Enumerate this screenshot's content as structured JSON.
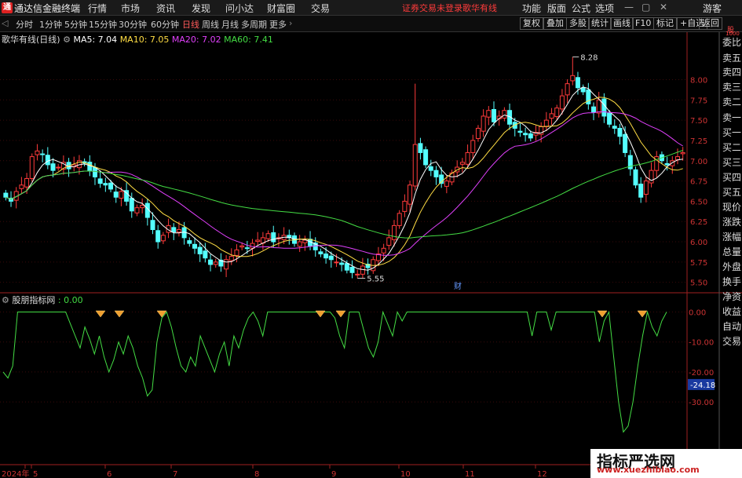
{
  "app": {
    "logo_char": "通",
    "name": "通达信金融终端",
    "menus": [
      "行情",
      "市场",
      "资讯",
      "发现",
      "问小达",
      "财富圈",
      "交易"
    ],
    "warn": "证券交易未登录",
    "indicator_title": "歌华有线",
    "right_menus": [
      "功能",
      "版面",
      "公式",
      "选项"
    ],
    "guest": "游客"
  },
  "toolbar": {
    "periods": [
      "分时",
      "1分钟",
      "5分钟",
      "15分钟",
      "30分钟",
      "60分钟",
      "日线",
      "周线",
      "月线",
      "多周期",
      "更多"
    ],
    "active": "日线",
    "right": [
      "复权",
      "叠加",
      "多股",
      "统计",
      "画线",
      "F10",
      "标记",
      "+自选",
      "返回"
    ]
  },
  "main_legend": {
    "title": "歌华有线(日线)",
    "ma": [
      {
        "label": "MA5: 7.04",
        "color": "#ffffff"
      },
      {
        "label": "MA10: 7.05",
        "color": "#ffdd44"
      },
      {
        "label": "MA20: 7.02",
        "color": "#e040fb"
      },
      {
        "label": "MA60: 7.41",
        "color": "#44dd44"
      }
    ]
  },
  "sub_legend": {
    "title": "股朋指标网",
    "value": ": 0.00",
    "value_color": "#44dd44"
  },
  "side_panel": [
    "委比",
    "卖五",
    "卖四",
    "卖三",
    "卖二",
    "卖一",
    "买一",
    "买二",
    "买三",
    "买四",
    "买五",
    "现价",
    "涨跌",
    "涨幅",
    "总量",
    "外盘",
    "换手",
    "净资",
    "收益",
    "自动",
    "交易"
  ],
  "side_top_labels": [
    "股",
    "1000"
  ],
  "watermark": {
    "title": "指标严选网",
    "url": "www.xuezhibiao.com"
  },
  "chart_data": [
    {
      "type": "candlestick",
      "title": "歌华有线(日线)",
      "ylim": [
        5.4,
        8.45
      ],
      "y_ticks": [
        5.5,
        5.75,
        6.0,
        6.25,
        6.5,
        6.75,
        7.0,
        7.25,
        7.5,
        7.75,
        8.0
      ],
      "x_labels": [
        "2024年",
        "5",
        "6",
        "7",
        "8",
        "9",
        "10",
        "11",
        "12"
      ],
      "annotations": [
        {
          "label": "8.28",
          "value": 8.28
        },
        {
          "label": "5.55",
          "value": 5.55
        }
      ],
      "event_markers": [
        "财"
      ],
      "close": [
        6.55,
        6.5,
        6.62,
        6.7,
        6.78,
        7.05,
        7.12,
        7.08,
        6.95,
        6.88,
        6.92,
        6.98,
        6.9,
        6.95,
        7.0,
        6.97,
        6.88,
        6.8,
        6.72,
        6.7,
        6.65,
        6.55,
        6.62,
        6.5,
        6.38,
        6.42,
        6.45,
        6.3,
        6.15,
        6.0,
        6.08,
        6.2,
        6.12,
        6.15,
        6.05,
        5.98,
        5.92,
        5.85,
        5.8,
        5.72,
        5.75,
        5.7,
        5.78,
        5.82,
        5.9,
        5.95,
        5.92,
        5.98,
        6.02,
        6.05,
        6.1,
        6.0,
        6.05,
        6.08,
        6.05,
        5.98,
        6.0,
        6.02,
        5.95,
        5.9,
        5.85,
        5.8,
        5.78,
        5.75,
        5.72,
        5.65,
        5.62,
        5.6,
        5.7,
        5.68,
        5.78,
        5.85,
        5.92,
        6.05,
        6.2,
        6.35,
        6.5,
        6.7,
        7.2,
        7.1,
        6.95,
        6.88,
        6.8,
        6.72,
        6.75,
        6.85,
        6.92,
        6.98,
        7.1,
        7.25,
        7.4,
        7.55,
        7.62,
        7.48,
        7.55,
        7.62,
        7.45,
        7.4,
        7.35,
        7.32,
        7.28,
        7.35,
        7.42,
        7.5,
        7.58,
        7.65,
        7.8,
        7.95,
        8.05,
        7.9,
        7.85,
        7.7,
        7.6,
        7.75,
        7.55,
        7.45,
        7.4,
        7.3,
        7.1,
        6.9,
        6.7,
        6.55,
        6.75,
        6.88,
        7.05,
        7.0,
        6.95,
        7.0,
        7.05,
        7.1
      ],
      "series": [
        {
          "name": "MA5",
          "color": "#ffffff",
          "last": 7.04
        },
        {
          "name": "MA10",
          "color": "#ffdd44",
          "last": 7.05
        },
        {
          "name": "MA20",
          "color": "#e040fb",
          "last": 7.02
        },
        {
          "name": "MA60",
          "color": "#44dd44",
          "last": 7.41
        }
      ]
    },
    {
      "type": "line",
      "title": "股朋指标网",
      "ylim": [
        -42,
        3
      ],
      "y_ticks": [
        0.0,
        -10.0,
        -20.0,
        -30.0
      ],
      "last_value": -24.18,
      "values": [
        -20,
        -22,
        -18,
        0,
        0,
        0,
        0,
        0,
        0,
        0,
        0,
        0,
        0,
        0,
        -4,
        -8,
        -12,
        -5,
        -9,
        -14,
        -8,
        -15,
        -20,
        -16,
        -10,
        -14,
        -8,
        -12,
        -18,
        -22,
        -28,
        -26,
        -10,
        -2,
        0,
        -5,
        -12,
        -18,
        -20,
        -15,
        -18,
        -8,
        -12,
        -16,
        -20,
        -14,
        -10,
        -18,
        -8,
        -12,
        -6,
        -2,
        0,
        -3,
        -8,
        0,
        0,
        0,
        0,
        0,
        0,
        0,
        0,
        0,
        0,
        0,
        0,
        0,
        0,
        -2,
        -8,
        -12,
        0,
        0,
        0,
        -6,
        -12,
        -15,
        -10,
        0,
        -4,
        -8,
        0,
        -3,
        0,
        0,
        0,
        0,
        0,
        0,
        0,
        0,
        0,
        0,
        0,
        0,
        0,
        0,
        0,
        0,
        0,
        0,
        0,
        0,
        0,
        0,
        0,
        0,
        0,
        0,
        -8,
        0,
        0,
        0,
        -6,
        0,
        0,
        0,
        0,
        0,
        0,
        0,
        0,
        0,
        -10,
        -3,
        0,
        -15,
        -30,
        -40,
        -38,
        -30,
        -18,
        -8,
        0,
        -5,
        -8,
        -3,
        0
      ],
      "signal_markers_count": 8
    }
  ]
}
